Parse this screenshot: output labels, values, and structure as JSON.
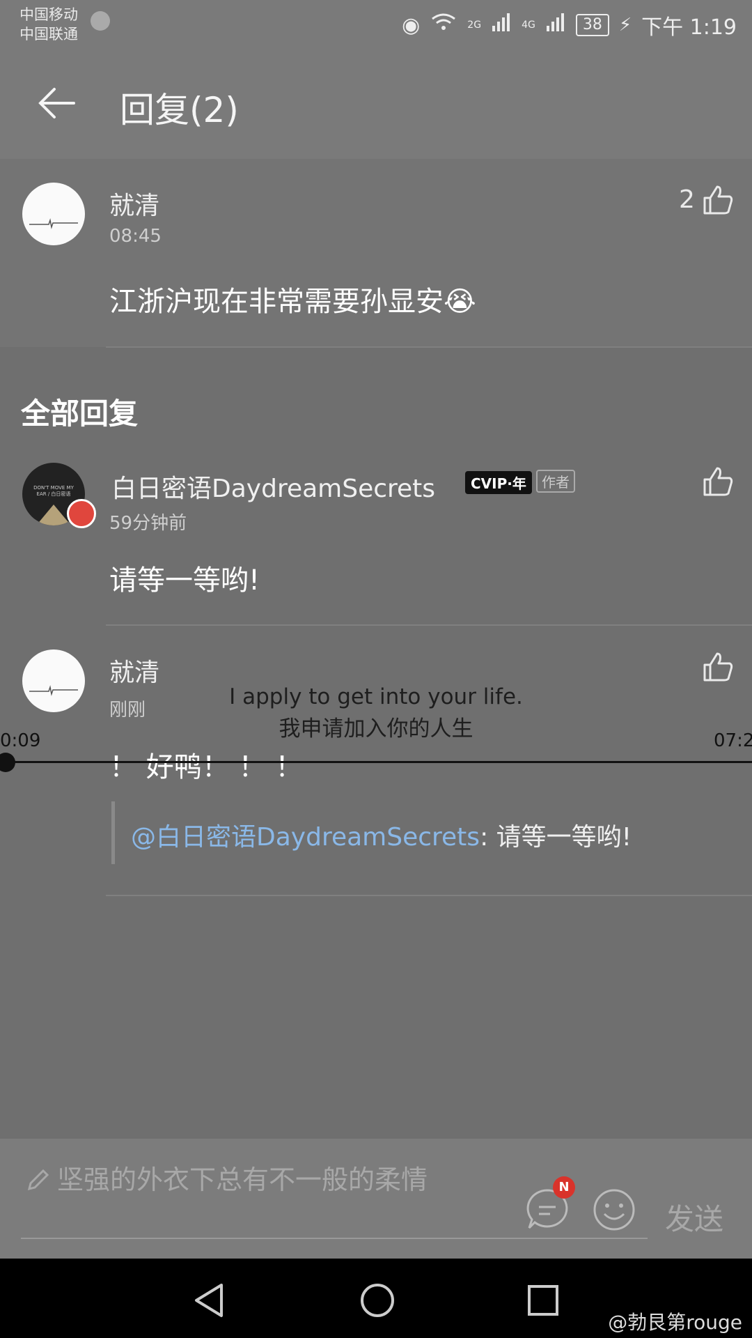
{
  "status_bar": {
    "carrier1": "中国移动",
    "carrier2": "中国联通",
    "net1": "2G",
    "net2": "4G",
    "battery": "38",
    "time": "下午 1:19"
  },
  "header": {
    "title": "回复(2)"
  },
  "original_comment": {
    "name": "就清",
    "time": "08:45",
    "likes": "2",
    "content": "江浙沪现在非常需要孙显安😭"
  },
  "section_title": "全部回复",
  "replies": [
    {
      "name": "白日密语DaydreamSecrets",
      "vip": "CVIP·年",
      "author_badge": "作者",
      "time": "59分钟前",
      "content": "请等一等哟!",
      "avatar_text": "DON'T MOVE MY EAR / 白日密语"
    },
    {
      "name": "就清",
      "time": "刚刚",
      "content": "！ 好鸭！ ！ ！",
      "quote_mention": "@白日密语DaydreamSecrets",
      "quote_text": ": 请等一等哟!"
    }
  ],
  "overlay": {
    "english": "I apply to get into your life.",
    "chinese": "我申请加入你的人生",
    "time_start": "0:09",
    "time_end": "07:2"
  },
  "input": {
    "placeholder": "坚强的外衣下总有不一般的柔情",
    "badge": "N",
    "send": "发送"
  },
  "watermark": "@勃艮第rouge"
}
